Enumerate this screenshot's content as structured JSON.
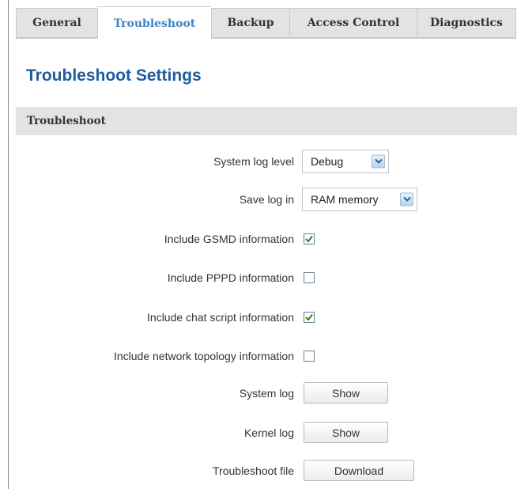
{
  "tabs": [
    {
      "label": "General",
      "active": false
    },
    {
      "label": "Troubleshoot",
      "active": true
    },
    {
      "label": "Backup",
      "active": false
    },
    {
      "label": "Access Control",
      "active": false
    },
    {
      "label": "Diagnostics",
      "active": false
    }
  ],
  "page_title": "Troubleshoot Settings",
  "section_title": "Troubleshoot",
  "fields": {
    "system_log_level": {
      "label": "System log level",
      "value": "Debug"
    },
    "save_log_in": {
      "label": "Save log in",
      "value": "RAM memory"
    },
    "include_gsmd": {
      "label": "Include GSMD information",
      "checked": true
    },
    "include_pppd": {
      "label": "Include PPPD information",
      "checked": false
    },
    "include_chat_script": {
      "label": "Include chat script information",
      "checked": true
    },
    "include_network_topology": {
      "label": "Include network topology information",
      "checked": false
    },
    "system_log": {
      "label": "System log",
      "button": "Show"
    },
    "kernel_log": {
      "label": "Kernel log",
      "button": "Show"
    },
    "troubleshoot_file": {
      "label": "Troubleshoot file",
      "button": "Download"
    }
  },
  "icons": {
    "dropdown": "chevron-down-icon",
    "check": "checkmark-icon"
  },
  "colors": {
    "active_tab_text": "#3a85c7",
    "title": "#1f5c9e",
    "section_bg": "#e3e3e3",
    "checkmark": "#3a7d1a"
  }
}
